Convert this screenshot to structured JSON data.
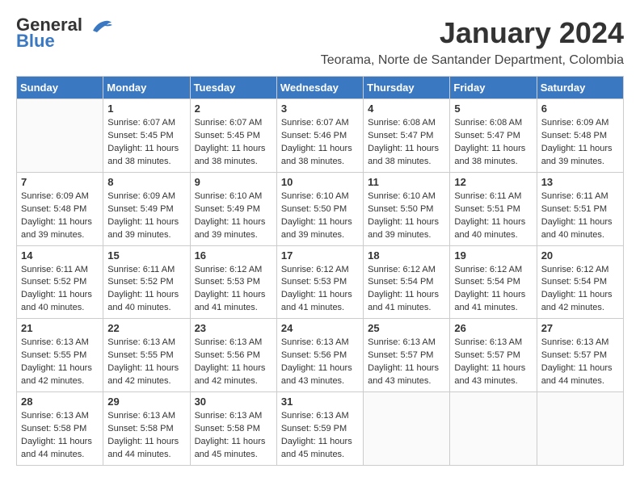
{
  "header": {
    "logo_general": "General",
    "logo_blue": "Blue",
    "title": "January 2024",
    "subtitle": "Teorama, Norte de Santander Department, Colombia"
  },
  "calendar": {
    "headers": [
      "Sunday",
      "Monday",
      "Tuesday",
      "Wednesday",
      "Thursday",
      "Friday",
      "Saturday"
    ],
    "weeks": [
      [
        {
          "day": "",
          "info": ""
        },
        {
          "day": "1",
          "info": "Sunrise: 6:07 AM\nSunset: 5:45 PM\nDaylight: 11 hours\nand 38 minutes."
        },
        {
          "day": "2",
          "info": "Sunrise: 6:07 AM\nSunset: 5:45 PM\nDaylight: 11 hours\nand 38 minutes."
        },
        {
          "day": "3",
          "info": "Sunrise: 6:07 AM\nSunset: 5:46 PM\nDaylight: 11 hours\nand 38 minutes."
        },
        {
          "day": "4",
          "info": "Sunrise: 6:08 AM\nSunset: 5:47 PM\nDaylight: 11 hours\nand 38 minutes."
        },
        {
          "day": "5",
          "info": "Sunrise: 6:08 AM\nSunset: 5:47 PM\nDaylight: 11 hours\nand 38 minutes."
        },
        {
          "day": "6",
          "info": "Sunrise: 6:09 AM\nSunset: 5:48 PM\nDaylight: 11 hours\nand 39 minutes."
        }
      ],
      [
        {
          "day": "7",
          "info": "Sunrise: 6:09 AM\nSunset: 5:48 PM\nDaylight: 11 hours\nand 39 minutes."
        },
        {
          "day": "8",
          "info": "Sunrise: 6:09 AM\nSunset: 5:49 PM\nDaylight: 11 hours\nand 39 minutes."
        },
        {
          "day": "9",
          "info": "Sunrise: 6:10 AM\nSunset: 5:49 PM\nDaylight: 11 hours\nand 39 minutes."
        },
        {
          "day": "10",
          "info": "Sunrise: 6:10 AM\nSunset: 5:50 PM\nDaylight: 11 hours\nand 39 minutes."
        },
        {
          "day": "11",
          "info": "Sunrise: 6:10 AM\nSunset: 5:50 PM\nDaylight: 11 hours\nand 39 minutes."
        },
        {
          "day": "12",
          "info": "Sunrise: 6:11 AM\nSunset: 5:51 PM\nDaylight: 11 hours\nand 40 minutes."
        },
        {
          "day": "13",
          "info": "Sunrise: 6:11 AM\nSunset: 5:51 PM\nDaylight: 11 hours\nand 40 minutes."
        }
      ],
      [
        {
          "day": "14",
          "info": "Sunrise: 6:11 AM\nSunset: 5:52 PM\nDaylight: 11 hours\nand 40 minutes."
        },
        {
          "day": "15",
          "info": "Sunrise: 6:11 AM\nSunset: 5:52 PM\nDaylight: 11 hours\nand 40 minutes."
        },
        {
          "day": "16",
          "info": "Sunrise: 6:12 AM\nSunset: 5:53 PM\nDaylight: 11 hours\nand 41 minutes."
        },
        {
          "day": "17",
          "info": "Sunrise: 6:12 AM\nSunset: 5:53 PM\nDaylight: 11 hours\nand 41 minutes."
        },
        {
          "day": "18",
          "info": "Sunrise: 6:12 AM\nSunset: 5:54 PM\nDaylight: 11 hours\nand 41 minutes."
        },
        {
          "day": "19",
          "info": "Sunrise: 6:12 AM\nSunset: 5:54 PM\nDaylight: 11 hours\nand 41 minutes."
        },
        {
          "day": "20",
          "info": "Sunrise: 6:12 AM\nSunset: 5:54 PM\nDaylight: 11 hours\nand 42 minutes."
        }
      ],
      [
        {
          "day": "21",
          "info": "Sunrise: 6:13 AM\nSunset: 5:55 PM\nDaylight: 11 hours\nand 42 minutes."
        },
        {
          "day": "22",
          "info": "Sunrise: 6:13 AM\nSunset: 5:55 PM\nDaylight: 11 hours\nand 42 minutes."
        },
        {
          "day": "23",
          "info": "Sunrise: 6:13 AM\nSunset: 5:56 PM\nDaylight: 11 hours\nand 42 minutes."
        },
        {
          "day": "24",
          "info": "Sunrise: 6:13 AM\nSunset: 5:56 PM\nDaylight: 11 hours\nand 43 minutes."
        },
        {
          "day": "25",
          "info": "Sunrise: 6:13 AM\nSunset: 5:57 PM\nDaylight: 11 hours\nand 43 minutes."
        },
        {
          "day": "26",
          "info": "Sunrise: 6:13 AM\nSunset: 5:57 PM\nDaylight: 11 hours\nand 43 minutes."
        },
        {
          "day": "27",
          "info": "Sunrise: 6:13 AM\nSunset: 5:57 PM\nDaylight: 11 hours\nand 44 minutes."
        }
      ],
      [
        {
          "day": "28",
          "info": "Sunrise: 6:13 AM\nSunset: 5:58 PM\nDaylight: 11 hours\nand 44 minutes."
        },
        {
          "day": "29",
          "info": "Sunrise: 6:13 AM\nSunset: 5:58 PM\nDaylight: 11 hours\nand 44 minutes."
        },
        {
          "day": "30",
          "info": "Sunrise: 6:13 AM\nSunset: 5:58 PM\nDaylight: 11 hours\nand 45 minutes."
        },
        {
          "day": "31",
          "info": "Sunrise: 6:13 AM\nSunset: 5:59 PM\nDaylight: 11 hours\nand 45 minutes."
        },
        {
          "day": "",
          "info": ""
        },
        {
          "day": "",
          "info": ""
        },
        {
          "day": "",
          "info": ""
        }
      ]
    ]
  }
}
